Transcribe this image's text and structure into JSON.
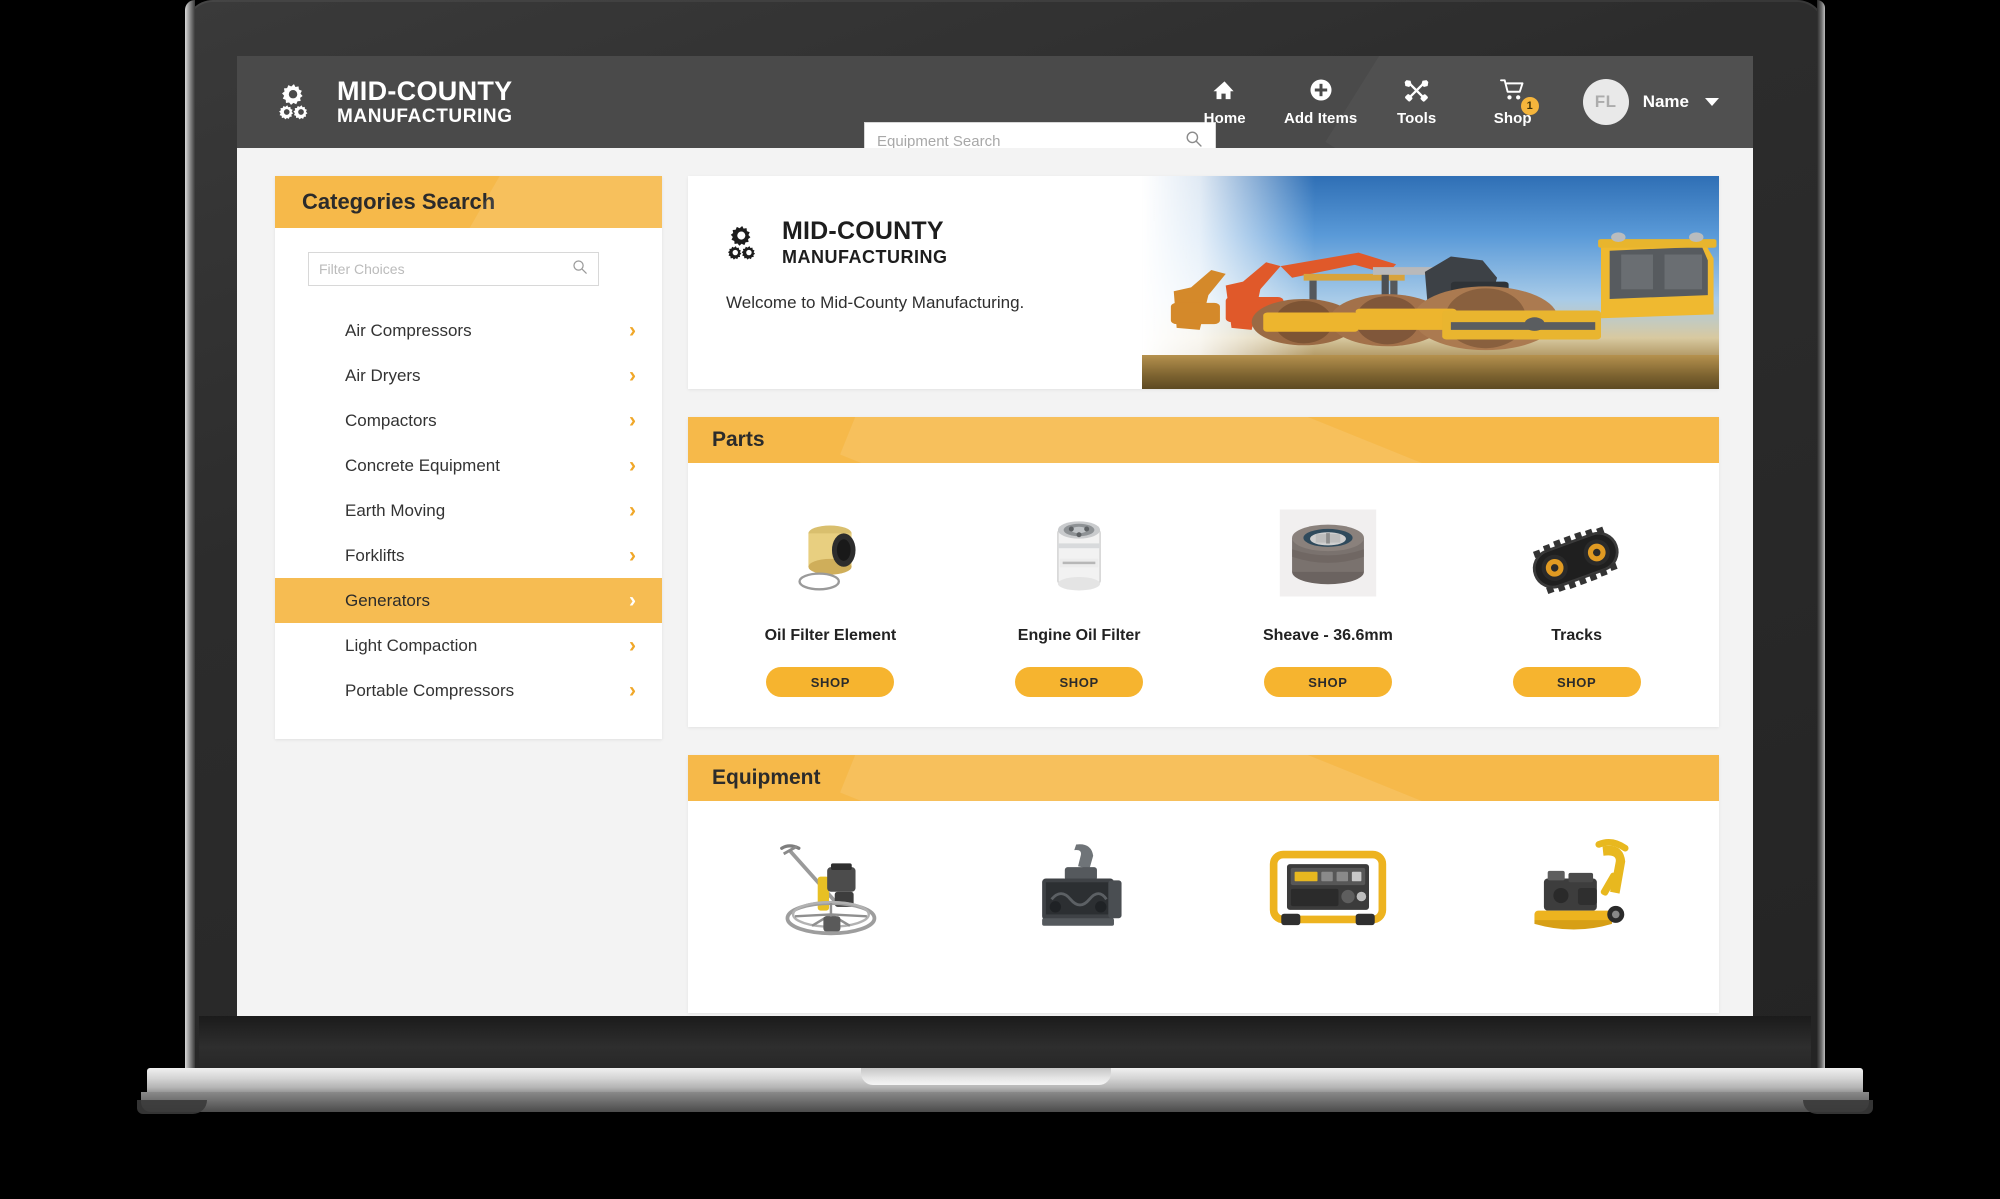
{
  "topbar": {
    "brand_line1": "MID-COUNTY",
    "brand_line2": "MANUFACTURING",
    "logo_icon": "gears-icon",
    "search": {
      "placeholder": "Equipment Search",
      "value": "",
      "icon": "search-icon"
    },
    "nav": [
      {
        "label": "Home",
        "icon": "home-icon"
      },
      {
        "label": "Add Items",
        "icon": "plus-circle-icon"
      },
      {
        "label": "Tools",
        "icon": "tools-icon"
      },
      {
        "label": "Shop",
        "icon": "cart-icon",
        "badge": "1"
      }
    ],
    "user": {
      "initials": "FL",
      "name": "Name",
      "chevron_icon": "chevron-down-icon"
    }
  },
  "sidebar": {
    "title": "Categories Search",
    "filter": {
      "placeholder": "Filter Choices",
      "value": "",
      "icon": "search-icon"
    },
    "chevron_icon": "chevron-right-icon",
    "items": [
      {
        "label": "Air Compressors",
        "active": false
      },
      {
        "label": "Air Dryers",
        "active": false
      },
      {
        "label": "Compactors",
        "active": false
      },
      {
        "label": "Concrete Equipment",
        "active": false
      },
      {
        "label": "Earth Moving",
        "active": false
      },
      {
        "label": "Forklifts",
        "active": false
      },
      {
        "label": "Generators",
        "active": true
      },
      {
        "label": "Light Compaction",
        "active": false
      },
      {
        "label": "Portable Compressors",
        "active": false
      }
    ]
  },
  "hero": {
    "logo_icon": "gears-icon",
    "title_line1": "MID-COUNTY",
    "title_line2": "MANUFACTURING",
    "welcome": "Welcome to Mid-County Manufacturing.",
    "image_alt": "construction-equipment-photo"
  },
  "sections": [
    {
      "title": "Parts",
      "products": [
        {
          "name": "Oil Filter Element",
          "button": "SHOP",
          "image": "oil-filter-element-photo"
        },
        {
          "name": "Engine Oil Filter",
          "button": "SHOP",
          "image": "engine-oil-filter-photo"
        },
        {
          "name": "Sheave - 36.6mm",
          "button": "SHOP",
          "image": "sheave-photo"
        },
        {
          "name": "Tracks",
          "button": "SHOP",
          "image": "rubber-tracks-photo"
        }
      ]
    },
    {
      "title": "Equipment",
      "products": [
        {
          "name": "",
          "button": "",
          "image": "power-trowel-photo"
        },
        {
          "name": "",
          "button": "",
          "image": "snow-blower-attachment-photo"
        },
        {
          "name": "",
          "button": "",
          "image": "portable-generator-photo"
        },
        {
          "name": "",
          "button": "",
          "image": "plate-compactor-photo"
        }
      ]
    }
  ],
  "colors": {
    "accent_orange": "#f6b94a",
    "button_orange": "#f6b42f",
    "topbar_gray": "#4a4a4a",
    "page_background": "#f3f3f3",
    "card_white": "#ffffff"
  }
}
